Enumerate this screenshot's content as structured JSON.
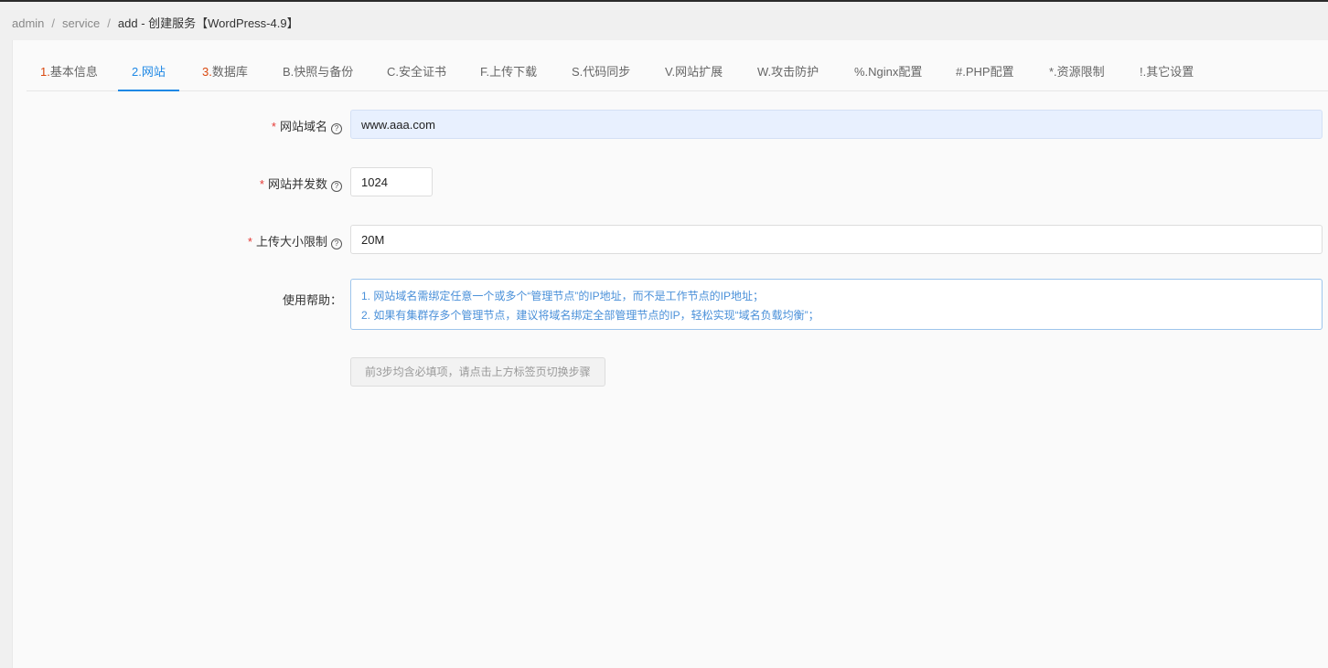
{
  "breadcrumb": {
    "items": [
      "admin",
      "service",
      "add"
    ],
    "separator": "/",
    "title": "- 创建服务【WordPress-4.9】"
  },
  "tabs": [
    {
      "num": "1.",
      "label": "基本信息",
      "active": false
    },
    {
      "num": "2.",
      "label": "网站",
      "active": true
    },
    {
      "num": "3.",
      "label": "数据库",
      "active": false
    },
    {
      "num": "",
      "label": "B.快照与备份",
      "active": false
    },
    {
      "num": "",
      "label": "C.安全证书",
      "active": false
    },
    {
      "num": "",
      "label": "F.上传下载",
      "active": false
    },
    {
      "num": "",
      "label": "S.代码同步",
      "active": false
    },
    {
      "num": "",
      "label": "V.网站扩展",
      "active": false
    },
    {
      "num": "",
      "label": "W.攻击防护",
      "active": false
    },
    {
      "num": "",
      "label": "%.Nginx配置",
      "active": false
    },
    {
      "num": "",
      "label": "#.PHP配置",
      "active": false
    },
    {
      "num": "",
      "label": "*.资源限制",
      "active": false
    },
    {
      "num": "",
      "label": "!.其它设置",
      "active": false
    }
  ],
  "form": {
    "domain": {
      "required": "*",
      "label": "网站域名",
      "value": "www.aaa.com"
    },
    "concurrency": {
      "required": "*",
      "label": "网站并发数",
      "value": "1024"
    },
    "upload_limit": {
      "required": "*",
      "label": "上传大小限制",
      "value": "20M"
    },
    "help": {
      "label": "使用帮助：",
      "lines": [
        "1. 网站域名需绑定任意一个或多个“管理节点”的IP地址，而不是工作节点的IP地址；",
        "2. 如果有集群存多个管理节点，建议将域名绑定全部管理节点的IP，轻松实现“域名负载均衡”；"
      ]
    },
    "hint_button": "前3步均含必填项，请点击上方标签页切换步骤"
  },
  "icons": {
    "help": "question-circle-icon"
  },
  "colors": {
    "accent": "#1e88e5",
    "required": "#e53935",
    "step_number": "#d9480f",
    "help_text": "#4a90d9"
  }
}
